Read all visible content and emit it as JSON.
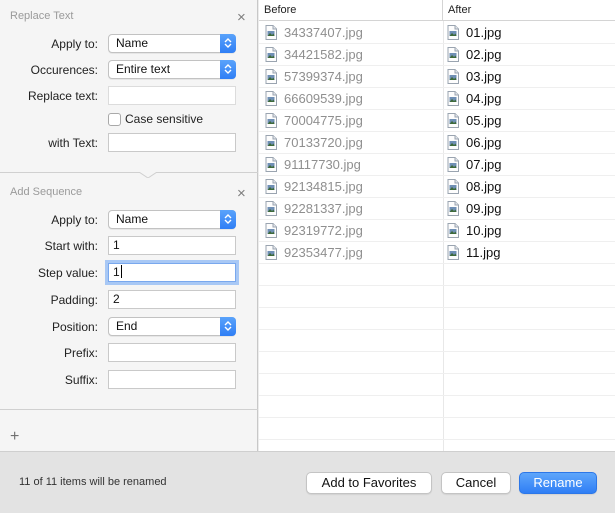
{
  "replace_text": {
    "title": "Replace Text",
    "apply_to_label": "Apply to:",
    "apply_to_value": "Name",
    "occurrences_label": "Occurences:",
    "occurrences_value": "Entire text",
    "replace_text_label": "Replace text:",
    "replace_text_value": "",
    "case_sensitive_label": "Case sensitive",
    "case_sensitive_checked": false,
    "with_text_label": "with Text:",
    "with_text_value": ""
  },
  "add_sequence": {
    "title": "Add Sequence",
    "apply_to_label": "Apply to:",
    "apply_to_value": "Name",
    "start_with_label": "Start with:",
    "start_with_value": "1",
    "step_value_label": "Step value:",
    "step_value_value": "1",
    "padding_label": "Padding:",
    "padding_value": "2",
    "position_label": "Position:",
    "position_value": "End",
    "prefix_label": "Prefix:",
    "prefix_value": "",
    "suffix_label": "Suffix:",
    "suffix_value": ""
  },
  "add_action_symbol": "+",
  "close_symbol": "×",
  "table": {
    "headers": {
      "before": "Before",
      "after": "After"
    },
    "rows": [
      {
        "before": "34337407.jpg",
        "after": "01.jpg"
      },
      {
        "before": "34421582.jpg",
        "after": "02.jpg"
      },
      {
        "before": "57399374.jpg",
        "after": "03.jpg"
      },
      {
        "before": "66609539.jpg",
        "after": "04.jpg"
      },
      {
        "before": "70004775.jpg",
        "after": "05.jpg"
      },
      {
        "before": "70133720.jpg",
        "after": "06.jpg"
      },
      {
        "before": "91117730.jpg",
        "after": "07.jpg"
      },
      {
        "before": "92134815.jpg",
        "after": "08.jpg"
      },
      {
        "before": "92281337.jpg",
        "after": "09.jpg"
      },
      {
        "before": "92319772.jpg",
        "after": "10.jpg"
      },
      {
        "before": "92353477.jpg",
        "after": "11.jpg"
      }
    ]
  },
  "footer": {
    "status": "11 of 11 items will be renamed",
    "add_to_favorites": "Add to Favorites",
    "cancel": "Cancel",
    "rename": "Rename"
  },
  "colors": {
    "accent": "#2f7ef5",
    "focus_ring": "#a8c8f5"
  }
}
